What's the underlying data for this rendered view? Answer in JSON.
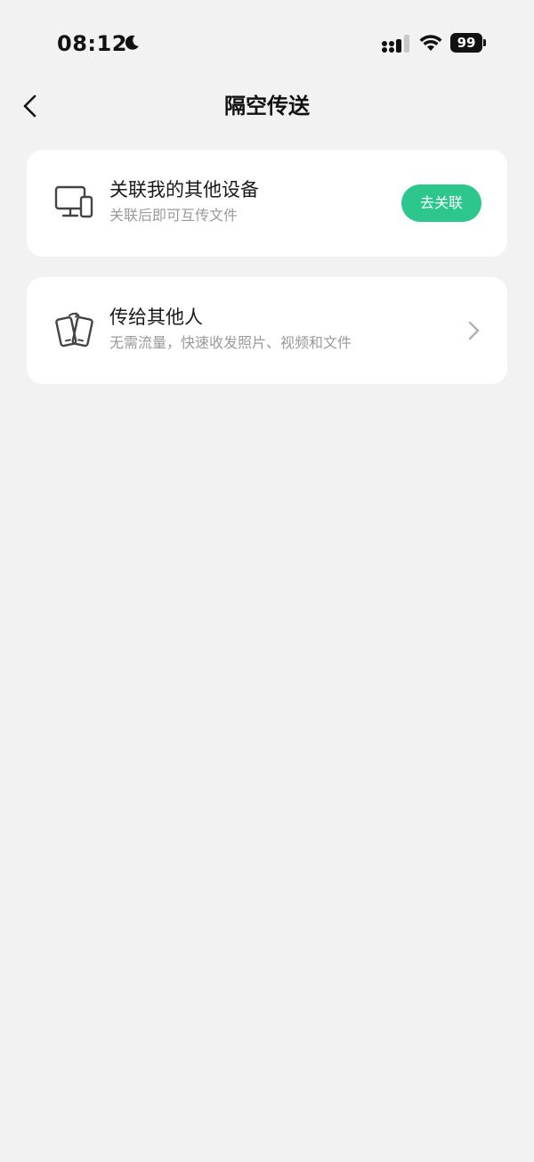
{
  "status_bar": {
    "time": "08:12",
    "battery": "99"
  },
  "nav": {
    "title": "隔空传送",
    "back_icon": "chevron-left-icon"
  },
  "cards": [
    {
      "icon": "devices-icon",
      "title": "关联我的其他设备",
      "subtitle": "关联后即可互传文件",
      "button_label": "去关联"
    },
    {
      "icon": "phones-transfer-icon",
      "title": "传给其他人",
      "subtitle": "无需流量，快速收发照片、视频和文件",
      "trailing_icon": "chevron-right-icon"
    }
  ],
  "colors": {
    "background": "#f2f2f2",
    "card": "#ffffff",
    "accent": "#2dc68c",
    "subtitle": "#9a9a9a"
  }
}
